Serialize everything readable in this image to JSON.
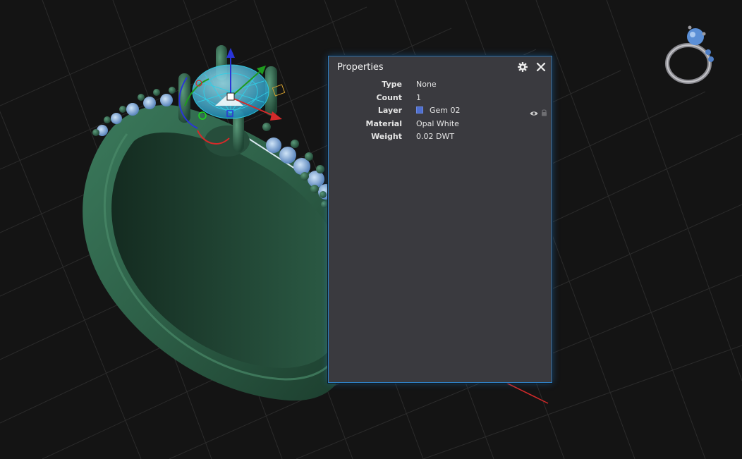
{
  "panel": {
    "title": "Properties",
    "settings_icon": "gear-icon",
    "close_icon": "close-icon"
  },
  "properties": {
    "type": {
      "label": "Type",
      "value": "None"
    },
    "count": {
      "label": "Count",
      "value": "1"
    },
    "layer": {
      "label": "Layer",
      "value": "Gem 02",
      "swatch_color": "#4f6fcf",
      "visibility_icon": "eye-icon",
      "lock_icon": "lock-icon"
    },
    "material": {
      "label": "Material",
      "value": "Opal White"
    },
    "weight": {
      "label": "Weight",
      "value": "0.02 DWT"
    }
  },
  "viewport": {
    "background": "#141414",
    "grid_color": "#2e2e2e",
    "metal_color": "#2f5e48",
    "gem_color": "#7aa6d8",
    "axis_x_color": "#d42a2a",
    "axis_y_color": "#1e9a1e",
    "axis_z_color": "#2a35d8",
    "selection_color": "#2fd0e8"
  }
}
